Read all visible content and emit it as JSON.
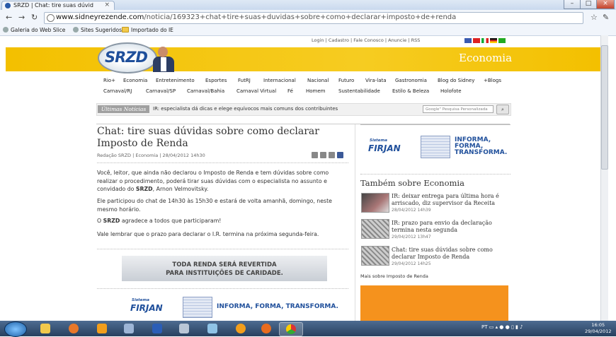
{
  "browser": {
    "tab_title": "SRZD | Chat: tire suas dúvid",
    "url_host": "www.sidneyrezende.com",
    "url_path": "/noticia/169323+chat+tire+suas+duvidas+sobre+como+declarar+imposto+de+renda",
    "bookmarks": [
      "Galeria do Web Slice",
      "Sites Sugeridos",
      "Importado do IE"
    ]
  },
  "site": {
    "top_links": "Login  |  Cadastro  |  Fale Conosco  |  Anuncie  |  RSS",
    "logo_text": "SRZD",
    "section": "Economia"
  },
  "nav": {
    "row1": [
      "Rio+",
      "Economia",
      "Entretenimento",
      "Esportes",
      "FutRJ",
      "Internacional",
      "Nacional",
      "Futuro",
      "Vira-lata",
      "Gastronomia",
      "Blog do Sidney",
      "+Blogs"
    ],
    "row2": [
      "Carnaval/RJ",
      "Carnaval/SP",
      "Carnaval/Bahia",
      "Carnaval Virtual",
      "Fé",
      "Homem",
      "Sustentabilidade",
      "Estilo & Beleza",
      "Holofote"
    ]
  },
  "ticker": {
    "label": "Últimas Notícias",
    "text": "IR: especialista dá dicas e elege equívocos mais comuns dos contribuintes",
    "search_placeholder": "Google\" Pesquisa Personalizada"
  },
  "article": {
    "title": "Chat: tire suas dúvidas sobre como declarar Imposto de Renda",
    "byline": "Redação SRZD | Economia | 28/04/2012 14h30",
    "p1_a": "Você, leitor, que ainda não declarou o Imposto de Renda e tem dúvidas sobre como realizar o procedimento, poderá tirar suas dúvidas com o especialista no assunto e convidado do ",
    "p1_bold": "SRZD",
    "p1_b": ", Arnon Velmovitsky.",
    "p2": "Ele participou do chat de 14h30 às 15h30 e estará de volta amanhã, domingo, neste mesmo horário.",
    "p3_a": "O ",
    "p3_bold": "SRZD",
    "p3_b": " agradece a todos que participaram!",
    "p4": "Vale lembrar que o prazo para declarar o I.R. termina na próxima segunda-feira."
  },
  "banners": {
    "renda_line1": "TODA RENDA SERÁ REVERTIDA",
    "renda_line2": "PARA INSTITUIÇÕES DE CARIDADE.",
    "firjan_sistema": "Sistema",
    "firjan_name": "FIRJAN",
    "firjan_tag_side": [
      "INFORMA,",
      "FORMA,",
      "TRANSFORMA."
    ],
    "firjan_tag_inline": "INFORMA, FORMA, TRANSFORMA."
  },
  "sidebar": {
    "heading": "Também sobre Economia",
    "items": [
      {
        "title": "IR: deixar entrega para última hora é arriscado, diz supervisor da Receita",
        "date": "28/04/2012 14h39"
      },
      {
        "title": "IR: prazo para envio da declaração termina nesta segunda",
        "date": "29/04/2012 13h47"
      },
      {
        "title": "Chat: tire suas dúvidas sobre como declarar Imposto de Renda",
        "date": "29/04/2012 14h25"
      }
    ],
    "more": "Mais sobre Imposto de Renda"
  },
  "taskbar": {
    "lang": "PT",
    "time": "16:05",
    "date": "29/04/2012"
  },
  "colors": {
    "header_yellow": "#f3c000",
    "firjan_blue": "#1f4f9b",
    "ad_orange": "#f5921d"
  }
}
